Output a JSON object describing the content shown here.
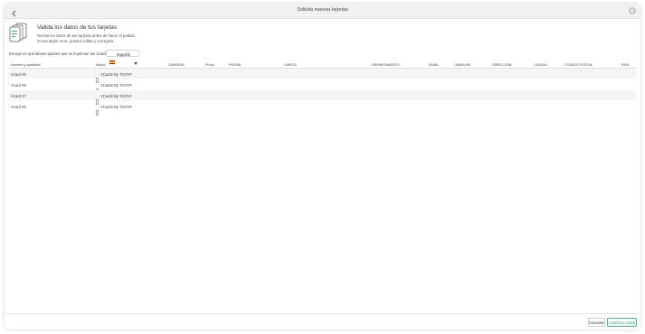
{
  "window": {
    "title": "Solicita nuevas tarjetas"
  },
  "header": {
    "title": "Valida los datos de tus tarjetas",
    "description_lines": [
      "Revisa los datos de tus tarjetas antes de hacer el pedido.",
      "Si ves algún error, puedes editar y corregirlo."
    ]
  },
  "language": {
    "label": "Escoge en qué idioma quieres que se impriman tus vcards",
    "selected": "Español",
    "flag_icon": "spain-flag-icon"
  },
  "table": {
    "columns": [
      "Nombre y apellidos",
      "Marca",
      "LINKEDIN",
      "Photo",
      "PHONE",
      "CARGO",
      "DEPARTAMENTO",
      "EMAIL",
      "LANDLINE",
      "DIRECCIÓN",
      "CIUDAD",
      "CODIGO POSTAL",
      "PAIS"
    ],
    "rows": [
      {
        "name": "Vcard #9",
        "brand": "VCards By TloTAP"
      },
      {
        "name": "Vcard #8",
        "brand": "VCards By TloTAP"
      },
      {
        "name": "Vcard #7",
        "brand": "VCards By TloTAP"
      },
      {
        "name": "Vcard #6",
        "brand": "VCards By TloTAP"
      }
    ]
  },
  "footer": {
    "cancel_label": "Cancelar",
    "confirm_label": "Confirmar datos"
  },
  "colors": {
    "accent": "#2f9f6c",
    "row_alt": "#f5f5f5"
  }
}
